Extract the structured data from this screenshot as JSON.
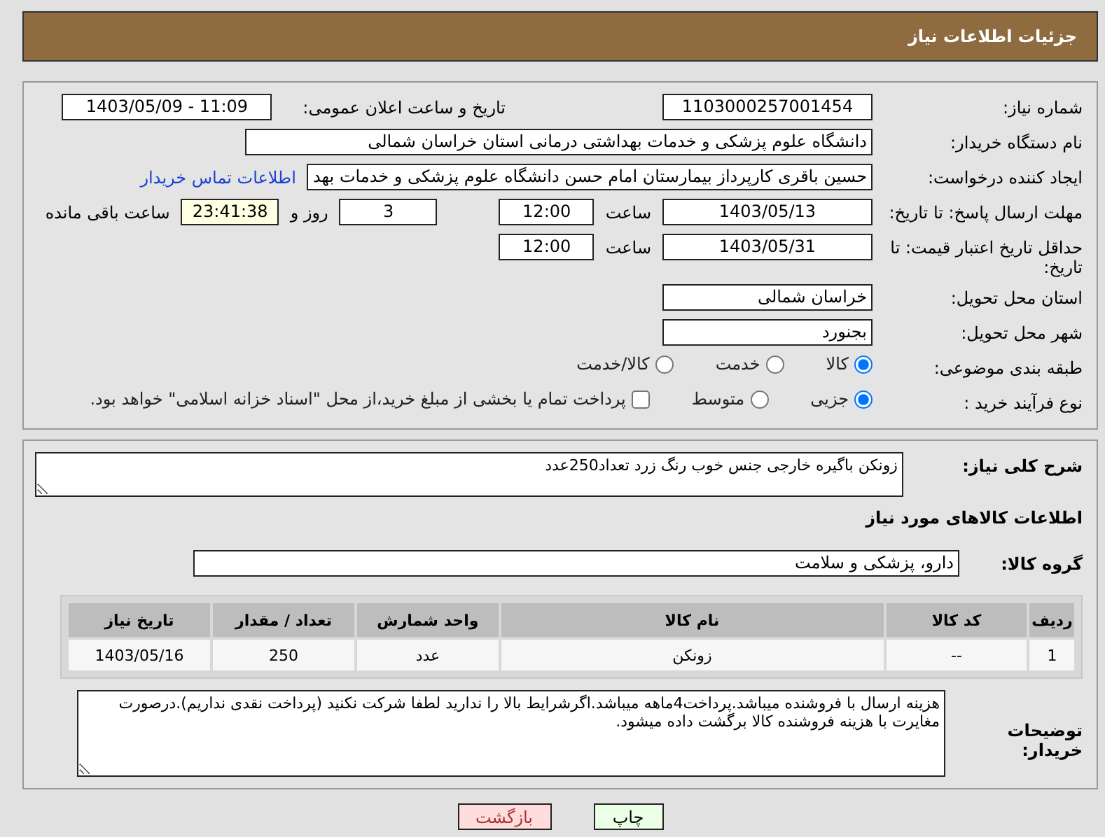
{
  "header": {
    "title": "جزئیات اطلاعات نیاز"
  },
  "need_number": {
    "label": "شماره نیاز:",
    "value": "1103000257001454"
  },
  "announce": {
    "label": "تاریخ و ساعت اعلان عمومی:",
    "value": "1403/05/09 - 11:09"
  },
  "buyer_org": {
    "label": "نام دستگاه خریدار:",
    "value": "دانشگاه علوم پزشکی و خدمات بهداشتی درمانی استان خراسان شمالی"
  },
  "requester": {
    "label": "ایجاد کننده درخواست:",
    "value": "حسین باقری کارپرداز بیمارستان امام حسن دانشگاه علوم پزشکی و خدمات بهد",
    "link": "اطلاعات تماس خریدار"
  },
  "deadline": {
    "label": "مهلت ارسال پاسخ: تا تاریخ:",
    "date": "1403/05/13",
    "time_label": "ساعت",
    "time": "12:00",
    "days": "3",
    "days_label": "روز و",
    "remaining": "23:41:38",
    "remaining_label": "ساعت باقی مانده"
  },
  "validity": {
    "label": "حداقل تاریخ اعتبار قیمت: تا تاریخ:",
    "date": "1403/05/31",
    "time_label": "ساعت",
    "time": "12:00"
  },
  "province": {
    "label": "استان محل تحویل:",
    "value": "خراسان شمالی"
  },
  "city": {
    "label": "شهر محل تحویل:",
    "value": "بجنورد"
  },
  "category": {
    "label": "طبقه بندی موضوعی:",
    "options": [
      {
        "label": "کالا",
        "selected": true
      },
      {
        "label": "خدمت",
        "selected": false
      },
      {
        "label": "کالا/خدمت",
        "selected": false
      }
    ]
  },
  "process": {
    "label": "نوع فرآیند خرید :",
    "options": [
      {
        "label": "جزیی",
        "selected": true
      },
      {
        "label": "متوسط",
        "selected": false
      }
    ],
    "payment": {
      "checked": false,
      "text": "پرداخت تمام یا بخشی از مبلغ خرید،از محل \"اسناد خزانه اسلامی\" خواهد بود."
    }
  },
  "summary": {
    "label": "شرح کلی نیاز:",
    "value": "زونکن باگیره خارجی جنس خوب رنگ زرد تعداد250عدد"
  },
  "goods_heading": "اطلاعات کالاهای مورد نیاز",
  "goods_group": {
    "label": "گروه کالا:",
    "value": "دارو، پزشکی و سلامت"
  },
  "table": {
    "columns": [
      "ردیف",
      "کد کالا",
      "نام کالا",
      "واحد شمارش",
      "تعداد / مقدار",
      "تاریخ نیاز"
    ],
    "rows": [
      [
        "1",
        "--",
        "زونکن",
        "عدد",
        "250",
        "1403/05/16"
      ]
    ]
  },
  "buyer_notes": {
    "label": "توضیحات خریدار:",
    "value": "هزینه ارسال با فروشنده میباشد.پرداخت4ماهه میباشد.اگرشرایط بالا را ندارید لطفا شرکت نکنید (پرداخت نقدی نداریم).درصورت مغایرت با هزینه فروشنده کالا برگشت داده میشود."
  },
  "buttons": [
    {
      "label": "چاپ",
      "kind": "print"
    },
    {
      "label": "بازگشت",
      "kind": "back"
    }
  ]
}
